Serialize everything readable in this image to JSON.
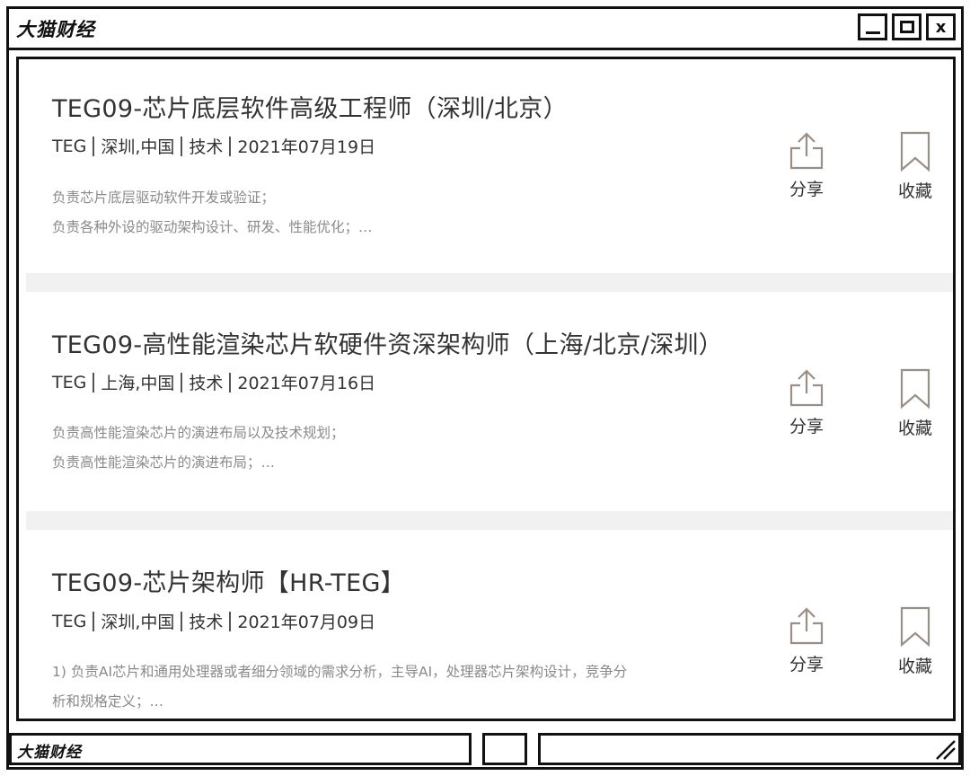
{
  "window": {
    "title": "大猫财经",
    "controls": {
      "minimize": "",
      "maximize": "",
      "close": "x"
    }
  },
  "jobs": [
    {
      "title": "TEG09-芯片底层软件高级工程师（深圳/北京）",
      "meta": [
        "TEG",
        "深圳,中国",
        "技术",
        "2021年07月19日"
      ],
      "desc": [
        "负责芯片底层驱动软件开发或验证；",
        "负责各种外设的驱动架构设计、研发、性能优化；…"
      ],
      "share_label": "分享",
      "save_label": "收藏"
    },
    {
      "title": "TEG09-高性能渲染芯片软硬件资深架构师（上海/北京/深圳）",
      "meta": [
        "TEG",
        "上海,中国",
        "技术",
        "2021年07月16日"
      ],
      "desc": [
        "负责高性能渲染芯片的演进布局以及技术规划；",
        "负责高性能渲染芯片的演进布局；…"
      ],
      "share_label": "分享",
      "save_label": "收藏"
    },
    {
      "title": "TEG09-芯片架构师【HR-TEG】",
      "meta": [
        "TEG",
        "深圳,中国",
        "技术",
        "2021年07月09日"
      ],
      "desc": [
        "1) 负责AI芯片和通用处理器或者细分领域的需求分析，主导AI，处理器芯片架构设计，竞争分",
        "析和规格定义；…"
      ],
      "share_label": "分享",
      "save_label": "收藏"
    }
  ],
  "statusbar": {
    "title": "大猫财经"
  },
  "colors": {
    "icon": "#9a8f86",
    "text": "#333333",
    "desc": "#8a8a8a",
    "separator": "#f1f1f1"
  }
}
